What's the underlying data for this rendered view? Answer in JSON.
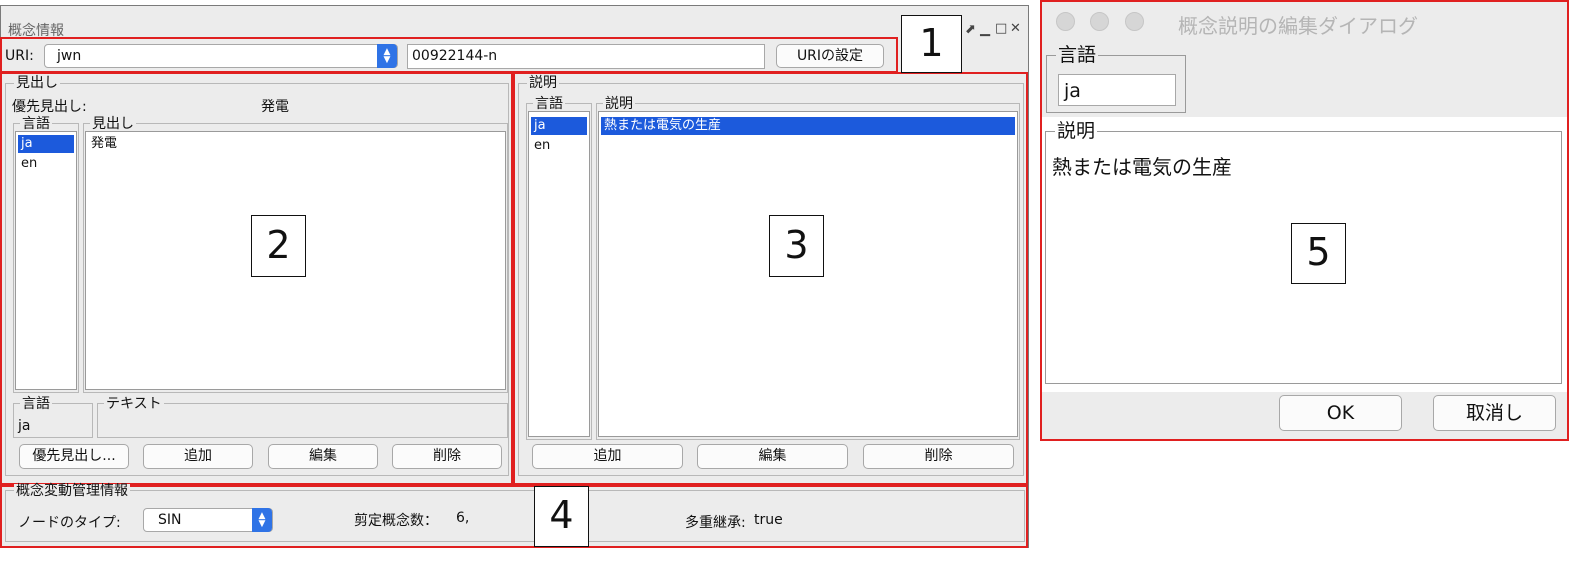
{
  "main_window": {
    "title": "概念情報",
    "title_icons": [
      "pin-icon",
      "minimize-icon",
      "maximize-icon",
      "close-icon"
    ],
    "uri_label": "URI:",
    "uri_combo_value": "jwn",
    "uri_field_value": "00922144-n",
    "uri_set_button": "URIの設定"
  },
  "heading_panel": {
    "title": "見出し",
    "preferred_label": "優先見出し:",
    "preferred_value": "発電",
    "lang_group": "言語",
    "langs": [
      "ja",
      "en"
    ],
    "heading_group": "見出し",
    "headings": [
      "発電"
    ],
    "lang_input_group": "言語",
    "lang_input_value": "ja",
    "text_group": "テキスト",
    "text_value": "",
    "buttons": {
      "preferred": "優先見出し...",
      "add": "追加",
      "edit": "編集",
      "delete": "削除"
    }
  },
  "description_panel": {
    "title": "説明",
    "lang_group": "言語",
    "langs": [
      "ja",
      "en"
    ],
    "desc_group": "説明",
    "descriptions": [
      "熱または電気の生産"
    ],
    "buttons": {
      "add": "追加",
      "edit": "編集",
      "delete": "削除"
    }
  },
  "concept_change_panel": {
    "title": "概念変動管理情報",
    "node_type_label": "ノードのタイプ:",
    "node_type_value": "SIN",
    "pruned_label": "剪定概念数：",
    "pruned_value": "6,",
    "multi_inherit_label": "多重継承:",
    "multi_inherit_value": "true"
  },
  "dialog": {
    "title": "概念説明の編集ダイアログ",
    "lang_group": "言語",
    "lang_value": "ja",
    "desc_group": "説明",
    "desc_value": "熱または電気の生産",
    "ok": "OK",
    "cancel": "取消し"
  },
  "annotations": [
    "1",
    "2",
    "3",
    "4",
    "5"
  ],
  "colors": {
    "highlight": "#e02020",
    "selection": "#1c5adc",
    "accent": "#2f73e6",
    "window_bg": "#ececec"
  }
}
